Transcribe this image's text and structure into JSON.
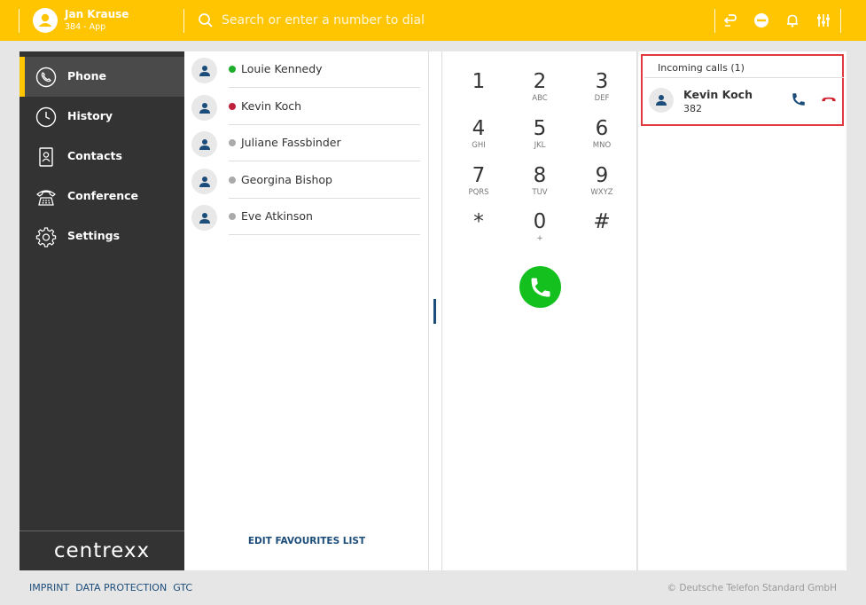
{
  "user": {
    "name": "Jan Krause",
    "extension": "384 - App"
  },
  "search": {
    "placeholder": "Search or enter a number to dial"
  },
  "header_buttons": [
    "call-forward-icon",
    "do-not-disturb-icon",
    "bell-icon",
    "settings-sliders-icon"
  ],
  "sidebar": {
    "items": [
      {
        "label": "Phone",
        "icon": "phone-icon",
        "active": true
      },
      {
        "label": "History",
        "icon": "clock-icon"
      },
      {
        "label": "Contacts",
        "icon": "contacts-book-icon"
      },
      {
        "label": "Conference",
        "icon": "conference-phone-icon"
      },
      {
        "label": "Settings",
        "icon": "gear-icon"
      }
    ],
    "brand": "centrexx"
  },
  "favourites": {
    "items": [
      {
        "name": "Louie Kennedy",
        "status_color": "#1eae2c"
      },
      {
        "name": "Kevin Koch",
        "status_color": "#c0203b"
      },
      {
        "name": "Juliane Fassbinder",
        "status_color": "#aaaaaa"
      },
      {
        "name": "Georgina Bishop",
        "status_color": "#aaaaaa"
      },
      {
        "name": "Eve Atkinson",
        "status_color": "#aaaaaa"
      }
    ],
    "edit_label": "EDIT FAVOURITES LIST"
  },
  "dialpad": {
    "keys": [
      {
        "digit": "1",
        "letters": ""
      },
      {
        "digit": "2",
        "letters": "ABC"
      },
      {
        "digit": "3",
        "letters": "DEF"
      },
      {
        "digit": "4",
        "letters": "GHI"
      },
      {
        "digit": "5",
        "letters": "JKL"
      },
      {
        "digit": "6",
        "letters": "MNO"
      },
      {
        "digit": "7",
        "letters": "PQRS"
      },
      {
        "digit": "8",
        "letters": "TUV"
      },
      {
        "digit": "9",
        "letters": "WXYZ"
      },
      {
        "digit": "*",
        "letters": ""
      },
      {
        "digit": "0",
        "letters": "+"
      },
      {
        "digit": "#",
        "letters": ""
      }
    ]
  },
  "incoming": {
    "title": "Incoming calls (1)",
    "calls": [
      {
        "name": "Kevin Koch",
        "number": "382"
      }
    ]
  },
  "footer": {
    "links": [
      "IMPRINT",
      "DATA PROTECTION",
      "GTC"
    ],
    "copyright": "© Deutsche Telefon Standard GmbH"
  },
  "colors": {
    "header": "#ffc501",
    "sidebar": "#333333",
    "accent_blue": "#1c4d7a",
    "call_green": "#14c01e",
    "reject_red": "#d0202e",
    "highlight_red": "#e0393e"
  }
}
